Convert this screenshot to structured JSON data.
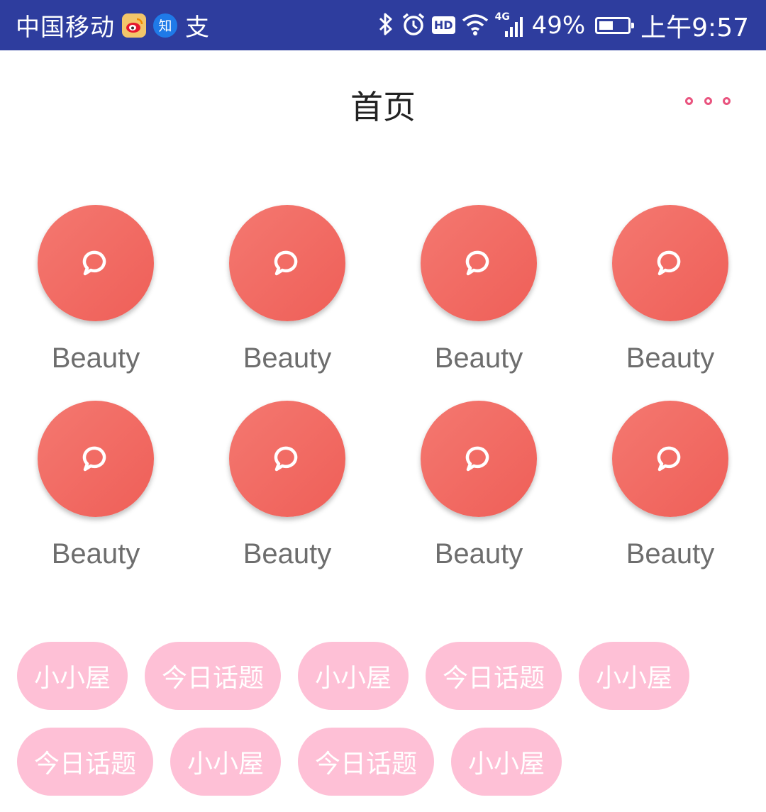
{
  "status_bar": {
    "carrier": "中国移动",
    "battery_percent": "49%",
    "battery_level": 0.49,
    "time": "上午9:57",
    "network": "4G",
    "hd_label": "HD",
    "notification_icons": [
      "weibo-icon",
      "zhihu-icon",
      "alipay-icon"
    ],
    "zhihu_glyph": "知",
    "alipay_glyph": "支",
    "system_icons": [
      "bluetooth-icon",
      "alarm-icon",
      "hd-icon",
      "wifi-icon",
      "signal-icon",
      "battery-icon"
    ],
    "background_color": "#2e3d9e"
  },
  "header": {
    "title": "首页",
    "more_icon": "more-dots-icon",
    "more_color": "#e9547f"
  },
  "grid": {
    "icon": "chat-bubble-icon",
    "circle_color": "#f26a63",
    "items": [
      {
        "label": "Beauty"
      },
      {
        "label": "Beauty"
      },
      {
        "label": "Beauty"
      },
      {
        "label": "Beauty"
      },
      {
        "label": "Beauty"
      },
      {
        "label": "Beauty"
      },
      {
        "label": "Beauty"
      },
      {
        "label": "Beauty"
      }
    ]
  },
  "tags": {
    "color": "#fec0d6",
    "items": [
      {
        "label": "小小屋"
      },
      {
        "label": "今日话题"
      },
      {
        "label": "小小屋"
      },
      {
        "label": "今日话题"
      },
      {
        "label": "小小屋"
      },
      {
        "label": "今日话题"
      },
      {
        "label": "小小屋"
      },
      {
        "label": "今日话题"
      },
      {
        "label": "小小屋"
      }
    ]
  }
}
